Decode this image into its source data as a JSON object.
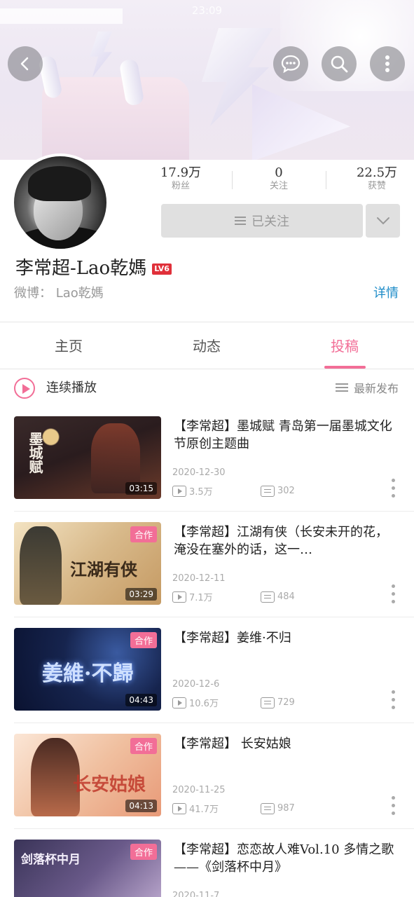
{
  "statusbar": {
    "time": "23:09"
  },
  "profile": {
    "fans_count": "17.9万",
    "fans_label": "粉丝",
    "following_count": "0",
    "following_label": "关注",
    "likes_count": "22.5万",
    "likes_label": "获赞",
    "follow_button": "已关注",
    "username": "李常超-Lao乾媽",
    "level_badge": "LV6",
    "weibo": "微博：  Lao乾媽",
    "detail_link": "详情"
  },
  "tabs": [
    {
      "label": "主页"
    },
    {
      "label": "动态"
    },
    {
      "label": "投稿"
    }
  ],
  "active_tab": "投稿",
  "playlist": {
    "label": "连续播放",
    "sort_label": "最新发布"
  },
  "videos": [
    {
      "thumb_text": "墨城赋",
      "duration": "03:15",
      "badge": "",
      "title": "【李常超】墨城赋 青岛第一届墨城文化节原创主题曲",
      "date": "2020-12-30",
      "plays": "3.5万",
      "danmaku": "302"
    },
    {
      "thumb_text": "江湖有侠",
      "duration": "03:29",
      "badge": "合作",
      "title": "【李常超】江湖有侠（长安未开的花，淹没在塞外的话，这一…",
      "date": "2020-12-11",
      "plays": "7.1万",
      "danmaku": "484"
    },
    {
      "thumb_text": "姜維·不歸",
      "duration": "04:43",
      "badge": "合作",
      "title": "【李常超】姜维·不归",
      "date": "2020-12-6",
      "plays": "10.6万",
      "danmaku": "729"
    },
    {
      "thumb_text": "长安姑娘",
      "duration": "04:13",
      "badge": "合作",
      "title": "【李常超】 长安姑娘",
      "date": "2020-11-25",
      "plays": "41.7万",
      "danmaku": "987"
    },
    {
      "thumb_text": "剑落杯中月",
      "duration": "",
      "badge": "合作",
      "title": "【李常超】恋恋故人难Vol.10 多情之歌——《剑落杯中月》",
      "date": "2020-11-7",
      "plays": "",
      "danmaku": ""
    }
  ]
}
